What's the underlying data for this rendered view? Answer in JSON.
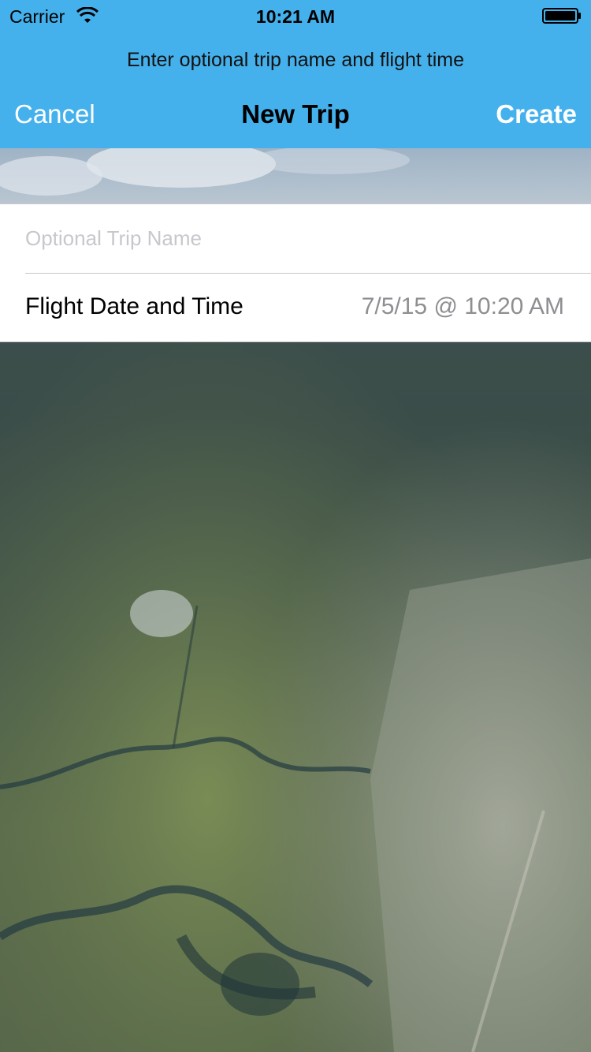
{
  "status_bar": {
    "carrier": "Carrier",
    "time": "10:21 AM",
    "wifi_icon": "wifi-icon",
    "battery_icon": "battery-full-icon"
  },
  "header": {
    "prompt": "Enter optional trip name and flight time",
    "cancel_label": "Cancel",
    "title": "New Trip",
    "create_label": "Create",
    "background_color": "#45b1ec"
  },
  "form": {
    "trip_name": {
      "value": "",
      "placeholder": "Optional Trip Name"
    },
    "flight_datetime": {
      "label": "Flight Date and Time",
      "value": "7/5/15 @ 10:20 AM"
    }
  }
}
